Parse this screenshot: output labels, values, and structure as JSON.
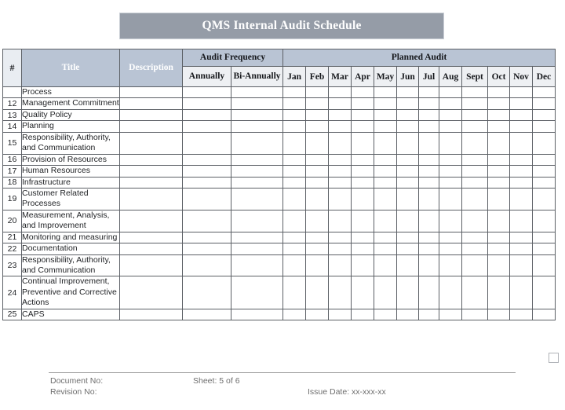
{
  "document": {
    "title": "QMS Internal Audit Schedule"
  },
  "table": {
    "headers": {
      "number": "#",
      "title": "Title",
      "description": "Description",
      "audit_frequency": "Audit Frequency",
      "annually": "Annually",
      "bi_annually": "Bi-Annually",
      "planned_audit": "Planned Audit",
      "months": [
        "Jan",
        "Feb",
        "Mar",
        "Apr",
        "May",
        "Jun",
        "Jul",
        "Aug",
        "Sept",
        "Oct",
        "Nov",
        "Dec"
      ]
    },
    "rows": [
      {
        "number": "",
        "title": "Process"
      },
      {
        "number": "12",
        "title": "Management Commitment"
      },
      {
        "number": "13",
        "title": "Quality Policy"
      },
      {
        "number": "14",
        "title": "Planning"
      },
      {
        "number": "15",
        "title": "Responsibility, Authority, and Communication"
      },
      {
        "number": "16",
        "title": "Provision of Resources"
      },
      {
        "number": "17",
        "title": "Human Resources"
      },
      {
        "number": "18",
        "title": "Infrastructure"
      },
      {
        "number": "19",
        "title": "Customer Related Processes"
      },
      {
        "number": "20",
        "title": "Measurement, Analysis, and Improvement"
      },
      {
        "number": "21",
        "title": "Monitoring and measuring"
      },
      {
        "number": "22",
        "title": "Documentation"
      },
      {
        "number": "23",
        "title": "Responsibility, Authority, and Communication"
      },
      {
        "number": "24",
        "title": "Continual Improvement, Preventive and Corrective Actions"
      },
      {
        "number": "25",
        "title": "CAPS"
      }
    ]
  },
  "footer": {
    "document_no": "Document No:",
    "revision_no": "Revision No:",
    "sheet": "Sheet: 5 of 6",
    "issue_date": "Issue Date: xx-xxx-xx"
  },
  "colors": {
    "title_banner_bg": "#959ca7",
    "header_bg": "#b9c4d4",
    "subheader_bg": "#eef0f3",
    "border": "#5c6066",
    "footer_text": "#6e6e6e"
  }
}
